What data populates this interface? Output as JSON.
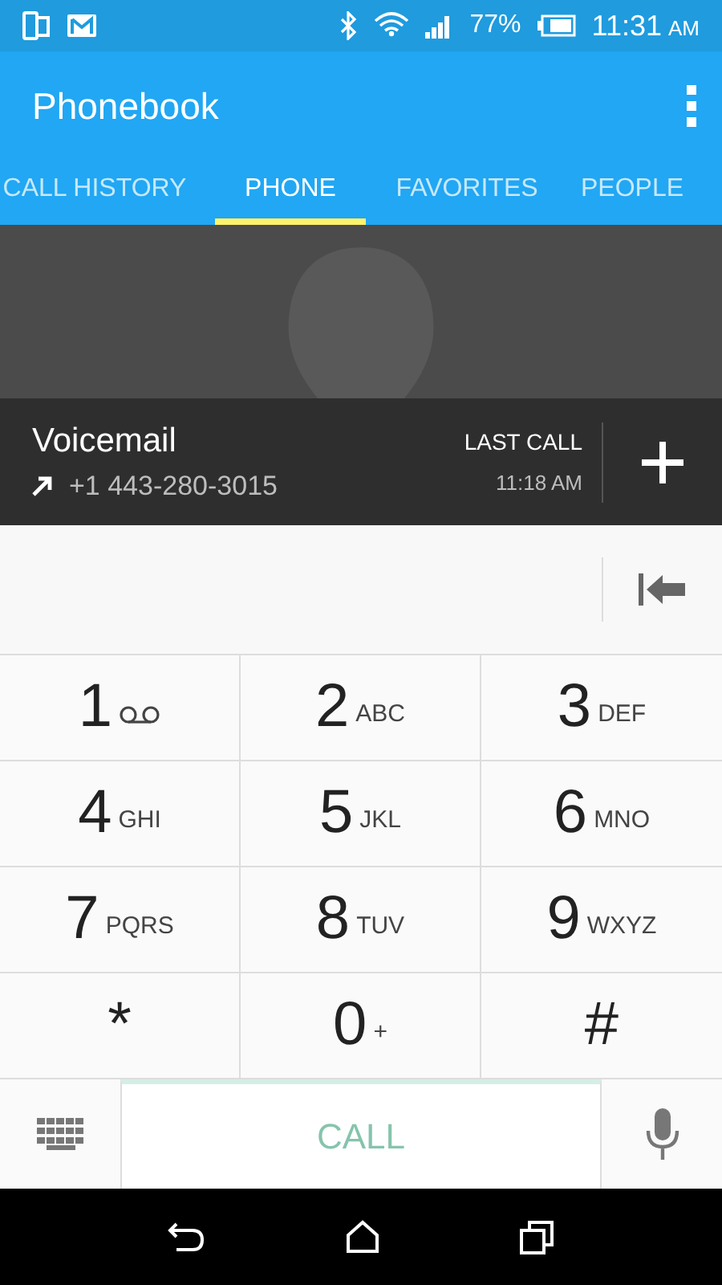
{
  "status_bar": {
    "battery": "77%",
    "time": "11:31",
    "ampm": "AM"
  },
  "app_bar": {
    "title": "Phonebook"
  },
  "tabs": [
    {
      "label": "CALL HISTORY",
      "selected": false
    },
    {
      "label": "PHONE",
      "selected": true
    },
    {
      "label": "FAVORITES",
      "selected": false
    },
    {
      "label": "PEOPLE",
      "selected": false
    }
  ],
  "contact": {
    "name": "Voicemail",
    "number": "+1 443-280-3015",
    "last_call_label": "LAST CALL",
    "last_call_time": "11:18 AM"
  },
  "keypad": [
    {
      "digit": "1",
      "kind": "voicemail"
    },
    {
      "digit": "2",
      "letters": "ABC",
      "kind": "letters"
    },
    {
      "digit": "3",
      "letters": "DEF",
      "kind": "letters"
    },
    {
      "digit": "4",
      "letters": "GHI",
      "kind": "letters"
    },
    {
      "digit": "5",
      "letters": "JKL",
      "kind": "letters"
    },
    {
      "digit": "6",
      "letters": "MNO",
      "kind": "letters"
    },
    {
      "digit": "7",
      "letters": "PQRS",
      "kind": "letters"
    },
    {
      "digit": "8",
      "letters": "TUV",
      "kind": "letters"
    },
    {
      "digit": "9",
      "letters": "WXYZ",
      "kind": "letters"
    },
    {
      "digit": "*",
      "kind": "symbol"
    },
    {
      "digit": "0",
      "letters": "+",
      "kind": "letters"
    },
    {
      "digit": "#",
      "kind": "symbol"
    }
  ],
  "call_button": {
    "label": "CALL",
    "disabled": true
  }
}
